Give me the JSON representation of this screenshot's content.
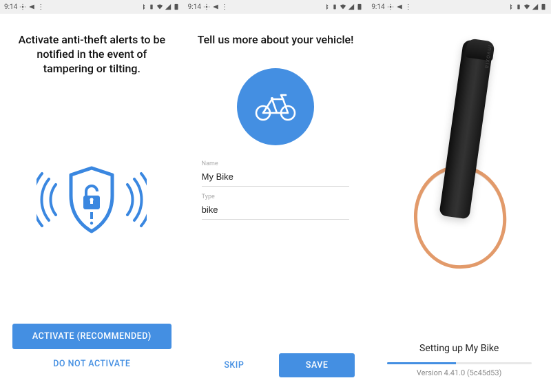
{
  "status": {
    "time": "9:14",
    "icons": [
      "gps",
      "voicemail",
      "bluetooth",
      "vibrate",
      "data",
      "wifi",
      "signal",
      "battery"
    ]
  },
  "screen1": {
    "heading": "Activate anti-theft alerts to be notified in the event of tampering or tilting.",
    "activate": "Activate (Recommended)",
    "skip": "Do not activate"
  },
  "screen2": {
    "heading": "Tell us more about your vehicle!",
    "icon": "bike",
    "nameLabel": "Name",
    "nameValue": "My Bike",
    "typeLabel": "Type",
    "typeValue": "bike",
    "skip": "Skip",
    "save": "Save"
  },
  "screen3": {
    "brand": "invoxia",
    "status": "Setting up My Bike",
    "progressPercent": 48,
    "versionPrefix": "Version",
    "version": "4.41.0 (5c45d53)"
  }
}
